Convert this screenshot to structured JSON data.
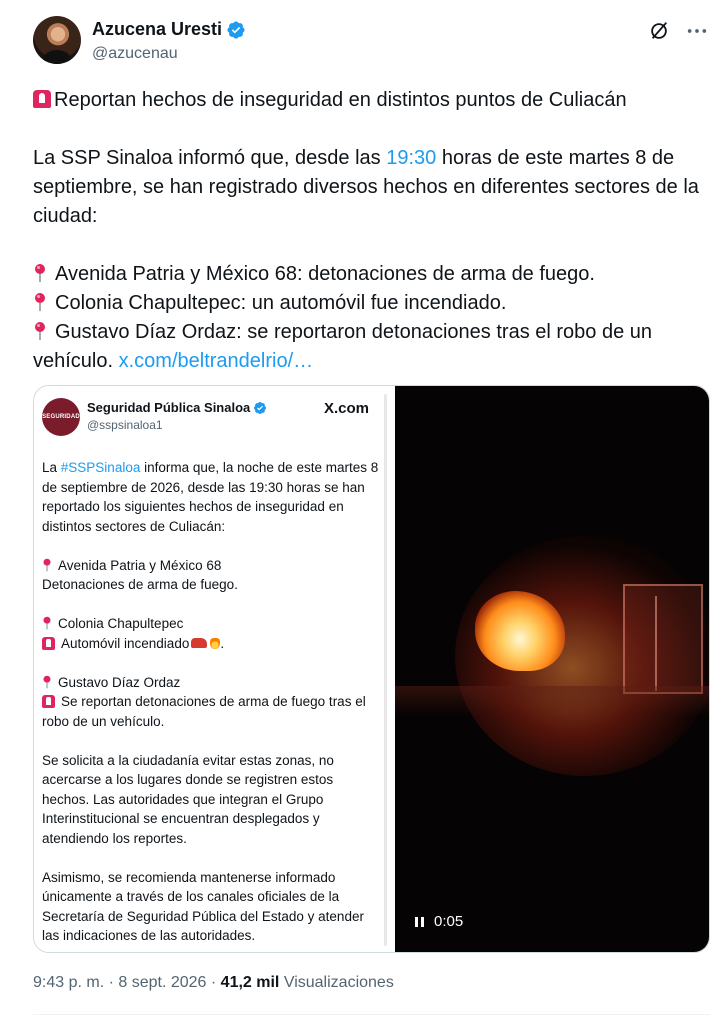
{
  "author": {
    "display_name": "Azucena Uresti",
    "handle": "@azucenau"
  },
  "tweet": {
    "headline": "Reportan hechos de inseguridad en distintos puntos de Culiacán",
    "intro_pre": "La SSP Sinaloa informó que, desde las ",
    "intro_time": "19:30",
    "intro_post": " horas de este martes 8 de septiembre, se han registrado diversos hechos en diferentes sectores de la ciudad:",
    "items": [
      "Avenida Patria y México 68: detonaciones de arma de fuego.",
      "Colonia Chapultepec: un automóvil fue incendiado.",
      "Gustavo Díaz Ordaz: se reportaron detonaciones tras el robo de un vehículo."
    ],
    "link": "x.com/beltrandelrio/…"
  },
  "embed": {
    "avatar_text": "SEGURIDAD",
    "name": "Seguridad Pública Sinaloa",
    "handle": "@sspsinaloa1",
    "brand": "X.com",
    "intro_pre": "La ",
    "hashtag": "#SSPSinaloa",
    "intro_post": " informa que, la noche de este martes 8 de septiembre de 2026, desde las 19:30 horas se han reportado los siguientes hechos de inseguridad en distintos sectores de Culiacán:",
    "place1": "Avenida Patria y México 68",
    "desc1": "Detonaciones de arma de fuego.",
    "place2": "Colonia Chapultepec",
    "desc2": "Automóvil incendiado",
    "desc2_suffix": ".",
    "place3": "Gustavo Díaz Ordaz",
    "desc3": "Se reportan detonaciones de arma de fuego tras el robo de un vehículo.",
    "para2": "Se solicita a la ciudadanía evitar estas zonas, no acercarse a los lugares donde se registren estos hechos. Las autoridades que integran el Grupo Interinstitucional se encuentran desplegados y atendiendo los reportes.",
    "para3": "Asimismo, se recomienda mantenerse informado únicamente a través de los canales oficiales de la Secretaría de Seguridad Pública del Estado y atender las indicaciones de las autoridades."
  },
  "video": {
    "time": "0:05"
  },
  "meta": {
    "time": "9:43 p. m.",
    "sep1": " · ",
    "date": "8 sept. 2026",
    "sep2": " · ",
    "views_count": "41,2 mil",
    "views_label": " Visualizaciones"
  },
  "colors": {
    "link": "#1d9bf0",
    "text": "#0f1419",
    "muted": "#536471"
  }
}
